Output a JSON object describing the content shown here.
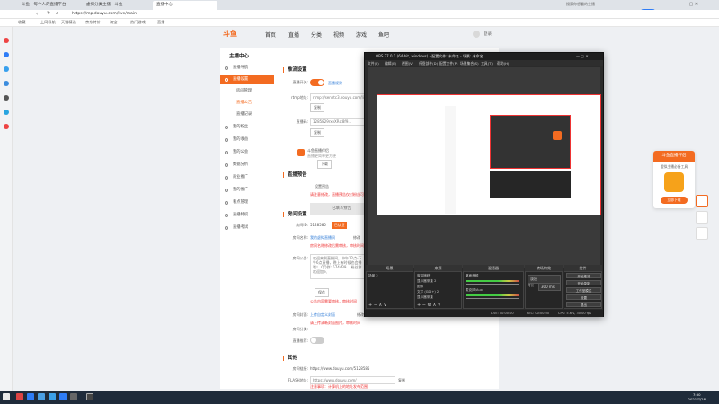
{
  "browser": {
    "tabs": [
      {
        "label": "斗鱼 - 每个人的直播平台"
      },
      {
        "label": "虚拟分类主播 - 斗鱼"
      },
      {
        "label": "直播中心"
      }
    ],
    "url": "https://mp.douyu.com/live/main",
    "search_placeholder": "搜索你想看的主播",
    "bookmarks": [
      "收藏",
      "上网导航",
      "天猫精选",
      "京东特价",
      "淘宝",
      "热门游戏",
      "直播"
    ],
    "user_label": "登录"
  },
  "site": {
    "logo": "斗鱼",
    "nav": [
      "首页",
      "直播",
      "分类",
      "视频",
      "游戏",
      "鱼吧"
    ]
  },
  "side_menu": {
    "title": "主播中心",
    "items": [
      {
        "label": "直播导航"
      },
      {
        "label": "直播设置"
      },
      {
        "label": "房间管理"
      },
      {
        "label": "直播公告"
      },
      {
        "label": "直播记录"
      },
      {
        "label": "我的粉丝"
      },
      {
        "label": "我的收益"
      },
      {
        "label": "我的公会"
      },
      {
        "label": "数据分析"
      },
      {
        "label": "商业推广"
      },
      {
        "label": "我的推广"
      },
      {
        "label": "看点管理"
      },
      {
        "label": "直播特权"
      },
      {
        "label": "直播考试"
      }
    ]
  },
  "main": {
    "sec1": "推流设置",
    "rtmp_label": "直播开关:",
    "rtmp_link": "直播规则",
    "rtmp_url_label": "rtmp地址:",
    "rtmp_url": "rtmp://sendtc3.douyu.com/live",
    "copy": "复制",
    "code_label": "直播码:",
    "code": "1285829rxeXRcl8f9...",
    "copy2": "复制",
    "tool_name": "斗鱼直播伴侣",
    "tool_desc": "直播更简单更方便",
    "tool_btn": "下载",
    "sec2": "直播预告",
    "preview_label": "设置预告",
    "preview_note": "请注意修改，直播预告仅对粉丝可见",
    "apply_btn": "已填写预告",
    "sec3": "房间设置",
    "room_id_label": "房间ID:",
    "room_id": "5128585",
    "room_id_badge": "已认证",
    "room_name_label": "房间名称:",
    "room_name": "我的虚拟直播间",
    "room_name_btn": "修改",
    "room_name_note": "房间名称修改后需审核，审核时间",
    "notice_label": "房间公告:",
    "notice_text": "欢迎来到直播间，中午12点-下午6点直播，晚上有时候也会播哦！ QQ群: 574439... 粉丝群欢迎加入",
    "notice_btn": "保存",
    "notice_note": "公告内容需要审核，审核时间",
    "cover_label": "房间封面:",
    "cover_link": "上传自定义封面",
    "cover_btn": "修改",
    "cover_note": "请上传清晰封面图片，审核时间",
    "category_label": "房间分类:",
    "rec_label": "直播推荐:",
    "sec4": "其他",
    "share_label": "房间链接:",
    "share_url": "https://www.douyu.com/5128585",
    "flash_label": "FLASH地址:",
    "flash_url": "https://www.douyu.com/",
    "flash_btn": "复制",
    "footer_note": "注意事项：计算机上的地址发布范围"
  },
  "obs": {
    "title": "OBS 27.0.1 (64-bit, windows) - 配置文件: 未命名 - 场景: 未命名",
    "menu": [
      "文件(F)",
      "编辑(E)",
      "视图(V)",
      "停靠部件(D)",
      "配置文件(P)",
      "场景集合(S)",
      "工具(T)",
      "帮助(H)"
    ],
    "docks": [
      "场景",
      "来源",
      "混音器",
      "转场特效",
      "控件"
    ],
    "scenes": [
      "场景 2"
    ],
    "sources": [
      "窗口捕获",
      "显示器采集 2",
      "图像",
      "文字 (GDI+) 2",
      "显示器采集"
    ],
    "mixer": [
      "桌面音频",
      "麦克风/Aux"
    ],
    "transition": "淡出",
    "duration_label": "时长",
    "duration": "300 ms",
    "controls": [
      "开始推流",
      "开始录制",
      "工作室模式",
      "设置",
      "退出"
    ],
    "status": [
      "LIVE: 00:00:00",
      "REC: 00:00:00",
      "CPU: 5.6%, 30.00 fps"
    ]
  },
  "promo": {
    "title": "斗鱼直播伴侣",
    "sub": "虚拟主播必备工具",
    "btn": "立即下载"
  },
  "taskbar": {
    "time": "7:50",
    "date": "2021/7/28"
  }
}
